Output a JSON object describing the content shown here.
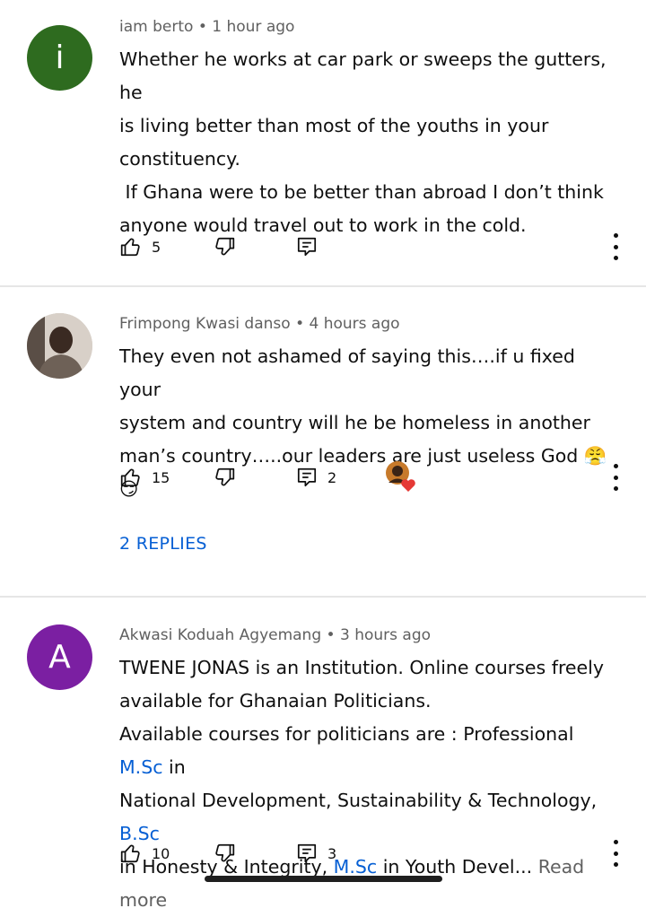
{
  "comments": [
    {
      "avatar_letter": "i",
      "avatar_color": "#2e6b1f",
      "author": "iam berto",
      "time": "1 hour ago",
      "lines": [
        "Whether he works at car park or sweeps the gutters, he",
        "is living better than most of the youths in your",
        "constituency.",
        " If Ghana were to be better than abroad I don’t think",
        "anyone would travel out to work in the cold."
      ],
      "likes": "5",
      "reply_count": ""
    },
    {
      "avatar_letter": "",
      "avatar_color": "#8a7b6e",
      "author": "Frimpong Kwasi danso",
      "time": "4 hours ago",
      "lines": [
        "They even not ashamed of saying this….if u fixed your",
        "system and country will he be homeless in another",
        "man’s country…..our leaders are just useless God 😤😏"
      ],
      "likes": "15",
      "reply_count": "2",
      "replies_label": "2 REPLIES"
    },
    {
      "avatar_letter": "A",
      "avatar_color": "#7b1fa2",
      "author": "Akwasi Koduah Agyemang",
      "time": "3 hours ago",
      "line1": "TWENE JONAS is an Institution. Online courses freely",
      "line2": "available for Ghanaian Politicians.",
      "line3_pre": "Available courses for politicians are : Professional ",
      "line3_link": "M.Sc",
      "line3_post": " in",
      "line4_pre": "National Development, Sustainability & Technology, ",
      "line4_link": "B.Sc",
      "line5_pre": "in Honesty & Integrity, ",
      "line5_link": "M.Sc",
      "line5_post": " in Youth Devel... ",
      "read_more": "Read more",
      "likes": "10",
      "reply_count": "3"
    }
  ],
  "separator": "•",
  "icons": {
    "like": "thumbs-up-icon",
    "dislike": "thumbs-down-icon",
    "reply": "reply-comment-icon",
    "more": "kebab-menu-icon",
    "creator_heart": "creator-heart-badge"
  },
  "colors": {
    "link": "#065fd4",
    "meta": "#606060",
    "text": "#0f0f0f",
    "heart": "#e53935"
  }
}
